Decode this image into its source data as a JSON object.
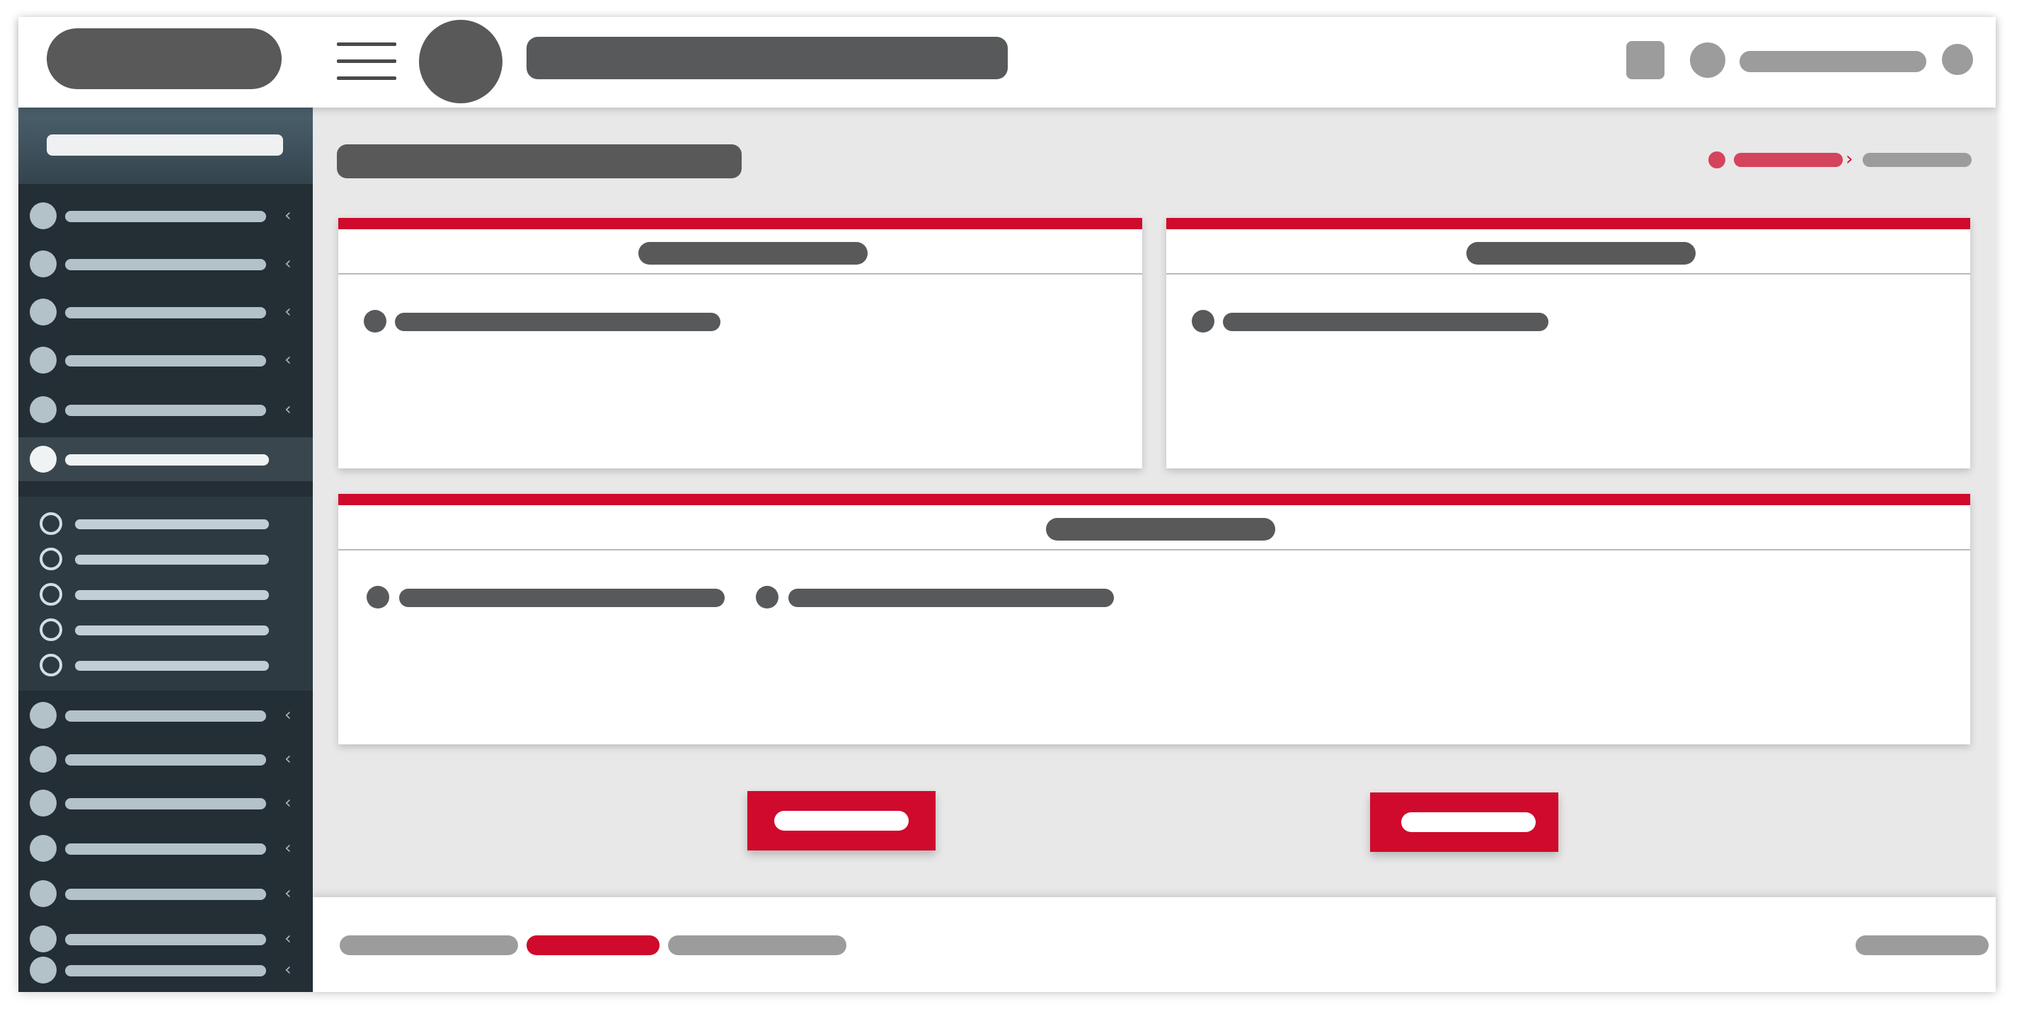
{
  "colors": {
    "accent_red": "#cf0a2c",
    "breadcrumb_red": "#d4445c",
    "header_dark": "#595959",
    "sidebar_bg": "#232e35",
    "sidebar_active": "#3a464e",
    "sidebar_submenu": "#2d3a42",
    "content_bg": "#e8e8e8"
  },
  "icons": {
    "menu": "hamburger-menu-icon",
    "avatar": "avatar-circle",
    "nav_chevron": "chevron-left-icon",
    "submenu_bullet": "ring-bullet-icon"
  },
  "sidebar": {
    "chevron": "‹",
    "items_before_submenu": 5,
    "items_after_submenu": 7,
    "submenu_items": 5
  }
}
